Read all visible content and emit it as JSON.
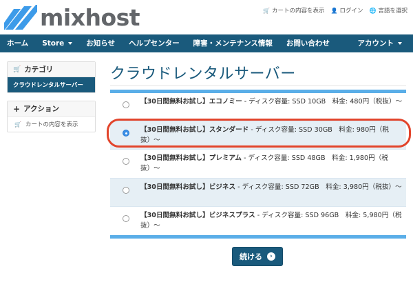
{
  "brand": {
    "name": "mixhost"
  },
  "toplinks": {
    "cart": "カートの内容を表示",
    "login": "ログイン",
    "language": "言語を選択"
  },
  "nav": {
    "items": [
      "ホーム",
      "Store",
      "お知らせ",
      "ヘルプセンター",
      "障害・メンテナンス情報",
      "お問い合わせ"
    ],
    "account": "アカウント"
  },
  "sidebar": {
    "category_title": "カテゴリ",
    "category_active": "クラウドレンタルサーバー",
    "action_title": "アクション",
    "action_item": "カートの内容を表示"
  },
  "main": {
    "title": "クラウドレンタルサーバー",
    "plans": [
      {
        "name": "【30日間無料お試し】エコノミー",
        "detail": " - ディスク容量: SSD 10GB　料金: 480円（税抜）〜",
        "selected": false
      },
      {
        "name": "【30日間無料お試し】スタンダード",
        "detail": " - ディスク容量: SSD 30GB　料金: 980円（税抜）〜",
        "selected": true
      },
      {
        "name": "【30日間無料お試し】プレミアム",
        "detail": " - ディスク容量: SSD 48GB　料金: 1,980円（税抜）〜",
        "selected": false
      },
      {
        "name": "【30日間無料お試し】ビジネス",
        "detail": " - ディスク容量: SSD 72GB　料金: 3,980円（税抜）〜",
        "selected": false
      },
      {
        "name": "【30日間無料お試し】ビジネスプラス",
        "detail": " - ディスク容量: SSD 96GB　料金: 5,980円（税抜）〜",
        "selected": false
      }
    ],
    "continue_label": "続ける"
  },
  "colors": {
    "primary": "#1a5a7c",
    "accent": "#5aaee8",
    "highlight": "#e2442b"
  }
}
